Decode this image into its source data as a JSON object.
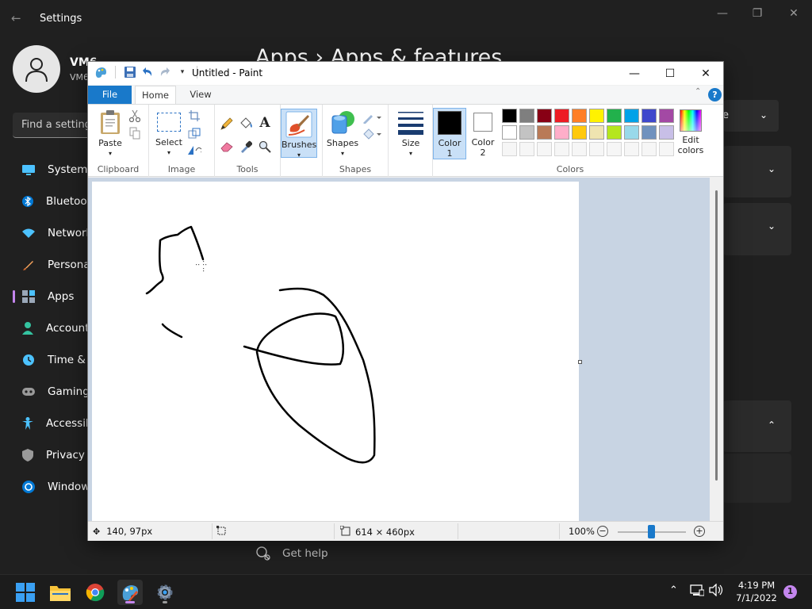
{
  "settings": {
    "title": "Settings",
    "user_name": "VM6",
    "user_sub": "VM6",
    "search_placeholder": "Find a setting",
    "heading": "Apps  ›  Apps & features",
    "nav": [
      {
        "label": "System",
        "icon": "monitor-icon"
      },
      {
        "label": "Bluetooth",
        "icon": "bluetooth-icon"
      },
      {
        "label": "Network",
        "icon": "wifi-icon"
      },
      {
        "label": "Personalization",
        "icon": "brush-icon"
      },
      {
        "label": "Apps",
        "icon": "apps-icon"
      },
      {
        "label": "Accounts",
        "icon": "person-icon"
      },
      {
        "label": "Time & language",
        "icon": "clock-icon"
      },
      {
        "label": "Gaming",
        "icon": "gamepad-icon"
      },
      {
        "label": "Accessibility",
        "icon": "accessibility-icon"
      },
      {
        "label": "Privacy & security",
        "icon": "shield-icon"
      },
      {
        "label": "Windows Update",
        "icon": "update-icon"
      }
    ],
    "dropdown_value": "re",
    "get_help": "Get help",
    "accent": "#c486ee"
  },
  "paint": {
    "title": "Untitled - Paint",
    "tabs": {
      "file": "File",
      "home": "Home",
      "view": "View"
    },
    "groups": {
      "clipboard": "Clipboard",
      "image": "Image",
      "tools": "Tools",
      "shapes": "Shapes",
      "colors": "Colors"
    },
    "buttons": {
      "paste": "Paste",
      "select": "Select",
      "brushes": "Brushes",
      "shapes": "Shapes",
      "size": "Size",
      "color1_line1": "Color",
      "color1_line2": "1",
      "color2_line1": "Color",
      "color2_line2": "2",
      "edit_colors_line1": "Edit",
      "edit_colors_line2": "colors"
    },
    "palette_row1": [
      "#000000",
      "#7f7f7f",
      "#880015",
      "#ed1c24",
      "#ff7f27",
      "#fff200",
      "#22b14c",
      "#00a2e8",
      "#3f48cc",
      "#a349a4"
    ],
    "palette_row2": [
      "#ffffff",
      "#c3c3c3",
      "#b97a57",
      "#ffaec9",
      "#ffc90e",
      "#efe4b0",
      "#b5e61d",
      "#99d9ea",
      "#7092be",
      "#c8bfe7"
    ],
    "color1": "#000000",
    "color2": "#ffffff",
    "status": {
      "cursor_pos": "140, 97px",
      "canvas_size": "614 × 460px",
      "zoom": "100%"
    },
    "accent": "#1979ca"
  },
  "taskbar": {
    "time": "4:19 PM",
    "date": "7/1/2022",
    "notifications": "1"
  }
}
